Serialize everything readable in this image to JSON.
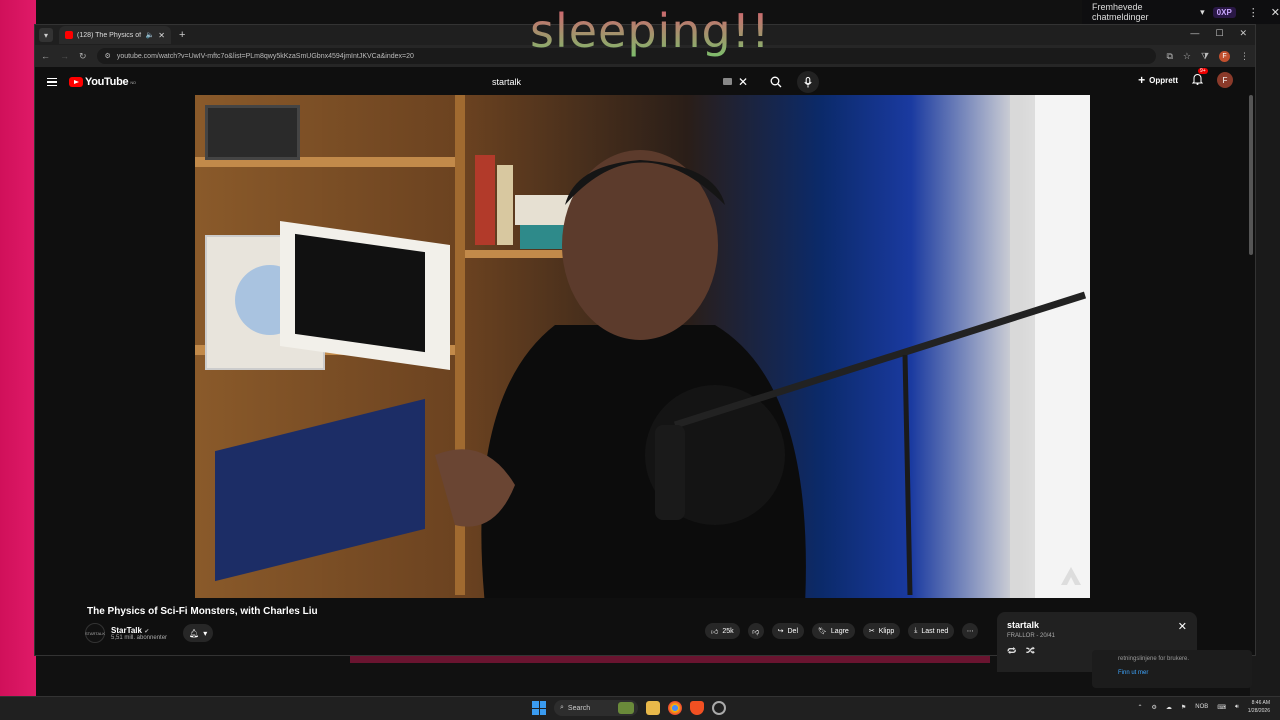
{
  "overlay": {
    "text": "sleeping!!"
  },
  "ext_bar": {
    "label": "Fremhevede chatmeldinger",
    "chip": "0XP"
  },
  "browser": {
    "tab_title": "(128) The Physics of Sci-Fi M",
    "url": "youtube.com/watch?v=UwIV-mftc7o&list=PLm8qwy5kKzaSmUGbnx4594jmIntJKVCa&index=20",
    "profile_letter": "F"
  },
  "youtube": {
    "logo_text": "YouTube",
    "logo_region": "NO",
    "search_value": "startalk",
    "create_label": "Opprett",
    "notif_badge": "9+",
    "avatar_letter": "F"
  },
  "video": {
    "title": "The Physics of Sci-Fi Monsters, with Charles Liu",
    "channel_name": "StarTalk",
    "channel_subs": "5,51 mill. abonnenter",
    "channel_avatar_text": "STARTALK",
    "like_count": "25k",
    "share_label": "Del",
    "save_label": "Lagre",
    "clip_label": "Klipp",
    "download_label": "Last ned"
  },
  "playlist": {
    "title": "startalk",
    "subtitle": "FRALLOR - 20/41"
  },
  "behind": {
    "text": "retningslinjene for brukere.",
    "link": "Finn ut mer"
  },
  "taskbar": {
    "search_label": "Search",
    "lang": "NOB",
    "time": "8:46 AM",
    "date": "1/28/2026"
  }
}
